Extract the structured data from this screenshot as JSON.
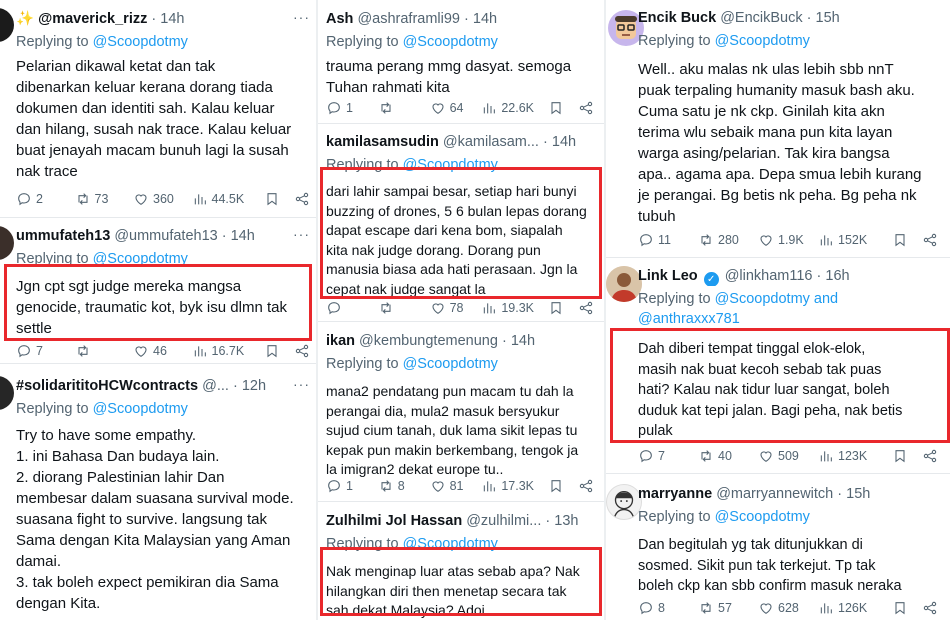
{
  "col1": {
    "t1": {
      "name": "✨ @maverick_rizz",
      "time": "14h",
      "reply_prefix": "Replying to",
      "reply_to": "@Scoopdotmy",
      "body": "Pelarian dikawal ketat dan tak\ndibenarkan keluar kerana dorang tiada\ndokumen dan identiti sah. Kalau keluar\ndan hilang, susah nak trace. Kalau keluar\nbuat jenayah macam bunuh lagi la susah\nnak trace",
      "replies": "2",
      "reposts": "73",
      "likes": "360",
      "views": "44.5K"
    },
    "t2": {
      "name": "ummufateh13",
      "handle": "@ummufateh13",
      "time": "14h",
      "reply_prefix": "Replying to",
      "reply_to": "@Scoopdotmy",
      "body": "Jgn cpt sgt judge mereka mangsa\ngenocide, traumatic kot, byk isu dlmn tak\nsettle",
      "replies": "7",
      "reposts": "",
      "likes": "46",
      "views": "16.7K"
    },
    "t3": {
      "name": "#solidarititoHCWcontracts",
      "handle": "@...",
      "time": "12h",
      "reply_prefix": "Replying to",
      "reply_to": "@Scoopdotmy",
      "body": "Try to have some empathy.\n1. ini Bahasa Dan budaya lain.\n2. diorang Palestinian lahir Dan\nmembesar dalam suasana survival mode.\nsuasana fight to survive. langsung tak\nSama dengan Kita Malaysian yang Aman\ndamai.\n3. tak boleh expect pemikiran dia Sama\ndengan Kita."
    }
  },
  "col2": {
    "t1": {
      "name": "Ash",
      "handle": "@ashraframli99",
      "time": "14h",
      "reply_prefix": "Replying to",
      "reply_to": "@Scoopdotmy",
      "body": "trauma perang mmg dasyat. semoga\nTuhan rahmati kita",
      "replies": "1",
      "reposts": "",
      "likes": "64",
      "views": "22.6K"
    },
    "t2": {
      "name": "kamilasamsudin",
      "handle": "@kamilasam...",
      "time": "14h",
      "reply_prefix": "Replying to",
      "reply_to": "@Scoopdotmy",
      "body": "dari lahir sampai besar, setiap hari bunyi\nbuzzing of drones, 5 6 bulan lepas dorang\ndapat escape dari kena bom, siapalah\nkita nak judge dorang. Dorang pun\nmanusia biasa ada hati perasaan. Jgn la\ncepat nak judge sangat la",
      "replies": "",
      "reposts": "",
      "likes": "78",
      "views": "19.3K"
    },
    "t3": {
      "name": "ikan",
      "handle": "@kembungtemenung",
      "time": "14h",
      "reply_prefix": "Replying to",
      "reply_to": "@Scoopdotmy",
      "body": "mana2 pendatang pun macam tu dah la\nperangai dia, mula2 masuk bersyukur\nsujud cium tanah, duk lama sikit lepas tu\nkepak pun makin berkembang, tengok ja\nla imigran2 dekat europe tu..",
      "replies": "1",
      "reposts": "8",
      "likes": "81",
      "views": "17.3K"
    },
    "t4": {
      "name": "Zulhilmi Jol Hassan",
      "handle": "@zulhilmi...",
      "time": "13h",
      "reply_prefix": "Replying to",
      "reply_to": "@Scoopdotmy",
      "body": "Nak menginap luar atas sebab apa? Nak\nhilangkan diri then menetap secara tak\nsah dekat Malaysia? Adoi"
    }
  },
  "col3": {
    "t1": {
      "name": "Encik Buck",
      "handle": "@EncikBuck",
      "time": "15h",
      "reply_prefix": "Replying to",
      "reply_to": "@Scoopdotmy",
      "body": "Well.. aku malas nk ulas lebih sbb nnT\npuak terpaling humanity masuk bash aku.\nCuma satu je nk ckp. Ginilah kita akn\nterima wlu sebaik mana pun kita layan\nwarga asing/pelarian. Tak kira bangsa\napa.. agama apa. Depa smua lebih kurang\nje perangai. Bg betis nk peha. Bg peha nk\ntubuh",
      "replies": "11",
      "reposts": "280",
      "likes": "1.9K",
      "views": "152K"
    },
    "t2": {
      "name": "Link Leo",
      "handle": "@linkham116",
      "time": "16h",
      "reply_prefix": "Replying to",
      "reply_to": "@Scoopdotmy and",
      "reply_to2": "@anthraxxx781",
      "body": "Dah diberi tempat tinggal elok-elok,\nmasih nak buat kecoh sebab tak puas\nhati? Kalau nak tidur luar sangat, boleh\nduduk kat tepi jalan. Bagi peha, nak betis\npulak",
      "replies": "7",
      "reposts": "40",
      "likes": "509",
      "views": "123K"
    },
    "t3": {
      "name": "marryanne",
      "handle": "@marryannewitch",
      "time": "15h",
      "reply_prefix": "Replying to",
      "reply_to": "@Scoopdotmy",
      "body": "Dan begitulah yg tak ditunjukkan di\nsosmed. Sikit pun tak terkejut. Tp tak\nboleh ckp kan sbb confirm masuk neraka",
      "replies": "8",
      "reposts": "57",
      "likes": "628",
      "views": "126K"
    }
  },
  "colors": {
    "highlight": "#e9282c",
    "link": "#1d9bf0",
    "muted": "#536471"
  }
}
